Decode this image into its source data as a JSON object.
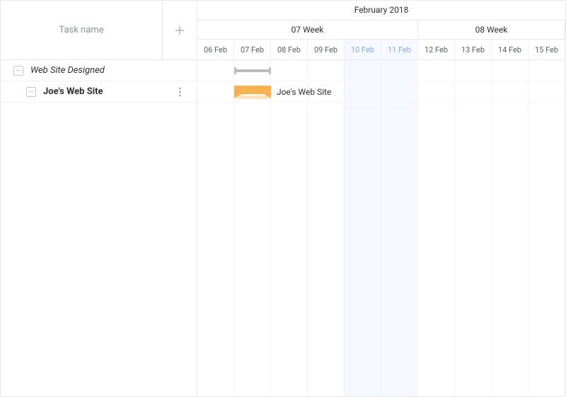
{
  "header": {
    "task_name_label": "Task name",
    "month_label": "February 2018"
  },
  "weeks": [
    {
      "label": "07 Week",
      "span_days": 6
    },
    {
      "label": "08 Week",
      "span_days": 4
    }
  ],
  "days": [
    {
      "label": "06 Feb",
      "weekend": false
    },
    {
      "label": "07 Feb",
      "weekend": false
    },
    {
      "label": "08 Feb",
      "weekend": false
    },
    {
      "label": "09 Feb",
      "weekend": false
    },
    {
      "label": "10 Feb",
      "weekend": true
    },
    {
      "label": "11 Feb",
      "weekend": true
    },
    {
      "label": "12 Feb",
      "weekend": false
    },
    {
      "label": "13 Feb",
      "weekend": false
    },
    {
      "label": "14 Feb",
      "weekend": false
    },
    {
      "label": "15 Feb",
      "weekend": false
    }
  ],
  "tasks": [
    {
      "name": "Web Site Designed",
      "type": "project",
      "start_day_index": 1,
      "end_day_index": 1,
      "level": 0
    },
    {
      "name": "Joe's Web Site",
      "type": "task",
      "start_day_index": 1,
      "end_day_index": 1,
      "level": 1,
      "bar_label": "Joe's Web Site"
    }
  ],
  "colors": {
    "task_bar": "#f7b24f",
    "project_bar": "#b9bcc0",
    "weekend_bg": "#f5f9ff",
    "weekend_text": "#8ca8d8",
    "border": "#e8e8e8"
  }
}
